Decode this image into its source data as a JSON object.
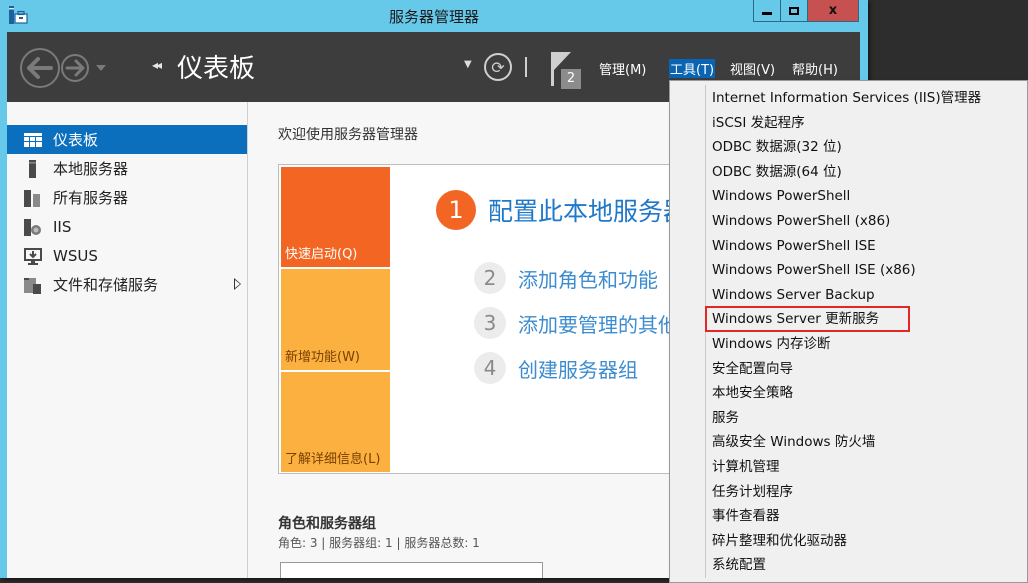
{
  "window": {
    "title": "服务器管理器",
    "controls": {
      "minimize": "minimize",
      "maximize": "maximize",
      "close": "x"
    }
  },
  "header": {
    "breadcrumb_arrows": "◂◂",
    "page_title": "仪表板",
    "notification_count": "2",
    "menus": [
      {
        "label": "管理(M)",
        "active": false
      },
      {
        "label": "工具(T)",
        "active": true
      },
      {
        "label": "视图(V)",
        "active": false
      },
      {
        "label": "帮助(H)",
        "active": false
      }
    ]
  },
  "sidebar": {
    "items": [
      {
        "label": "仪表板",
        "icon": "dashboard-icon",
        "active": true
      },
      {
        "label": "本地服务器",
        "icon": "local-server-icon",
        "active": false
      },
      {
        "label": "所有服务器",
        "icon": "all-servers-icon",
        "active": false
      },
      {
        "label": "IIS",
        "icon": "iis-icon",
        "active": false
      },
      {
        "label": "WSUS",
        "icon": "wsus-icon",
        "active": false
      },
      {
        "label": "文件和存储服务",
        "icon": "file-storage-icon",
        "active": false,
        "has_submenu": true
      }
    ]
  },
  "main": {
    "welcome_title": "欢迎使用服务器管理器",
    "tiles": [
      {
        "label": "快速启动(Q)"
      },
      {
        "label": "新增功能(W)"
      },
      {
        "label": "了解详细信息(L)"
      }
    ],
    "steps": [
      {
        "num": "1",
        "label": "配置此本地服务器"
      },
      {
        "num": "2",
        "label": "添加角色和功能"
      },
      {
        "num": "3",
        "label": "添加要管理的其他服务器"
      },
      {
        "num": "4",
        "label": "创建服务器组"
      }
    ],
    "roles_title": "角色和服务器组",
    "roles_summary": "角色: 3 | 服务器组: 1 | 服务器总数: 1"
  },
  "tools_menu": {
    "highlighted_index": 9,
    "highlight_color": "#e32626",
    "items": [
      "Internet Information Services (IIS)管理器",
      "iSCSI 发起程序",
      "ODBC 数据源(32 位)",
      "ODBC 数据源(64 位)",
      "Windows PowerShell",
      "Windows PowerShell (x86)",
      "Windows PowerShell ISE",
      "Windows PowerShell ISE (x86)",
      "Windows Server Backup",
      "Windows Server 更新服务",
      "Windows 内存诊断",
      "安全配置向导",
      "本地安全策略",
      "服务",
      "高级安全 Windows 防火墙",
      "计算机管理",
      "任务计划程序",
      "事件查看器",
      "碎片整理和优化驱动器",
      "系统配置"
    ]
  },
  "colors": {
    "title_bar": "#66c9ea",
    "header_bg": "#3d3d3d",
    "selection_blue": "#0b6fbd",
    "quick_start_orange": "#f26522",
    "tile_amber": "#fbb040",
    "link_blue": "#1f78c8"
  }
}
